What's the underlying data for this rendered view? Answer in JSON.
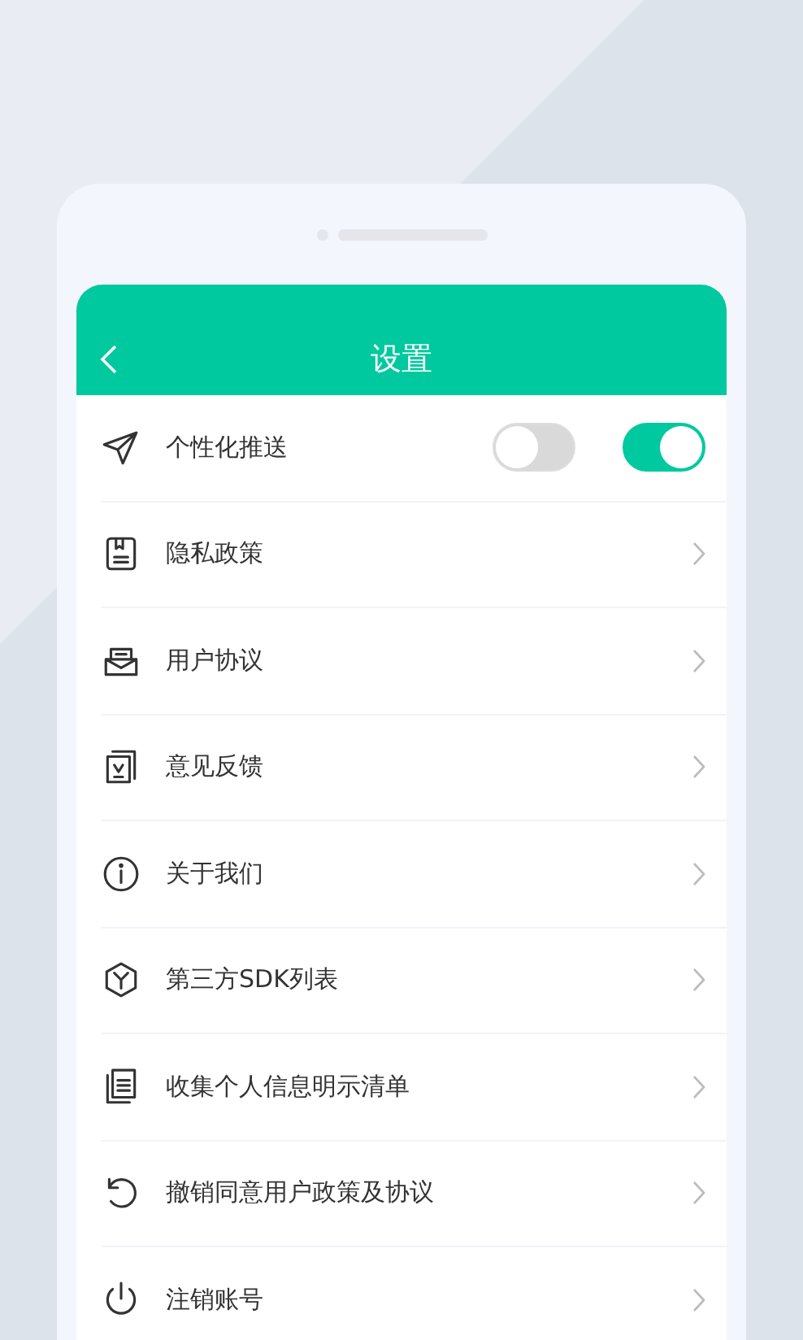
{
  "header": {
    "title": "设置"
  },
  "items": [
    {
      "kind": "toggle",
      "label": "个性化推送",
      "switches": [
        {
          "on": false
        },
        {
          "on": true
        }
      ]
    },
    {
      "kind": "link",
      "label": "隐私政策"
    },
    {
      "kind": "link",
      "label": "用户协议"
    },
    {
      "kind": "link",
      "label": "意见反馈"
    },
    {
      "kind": "link",
      "label": "关于我们"
    },
    {
      "kind": "link",
      "label": "第三方SDK列表"
    },
    {
      "kind": "link",
      "label": "收集个人信息明示清单"
    },
    {
      "kind": "link",
      "label": "撤销同意用户政策及协议"
    },
    {
      "kind": "link",
      "label": "注销账号"
    }
  ]
}
